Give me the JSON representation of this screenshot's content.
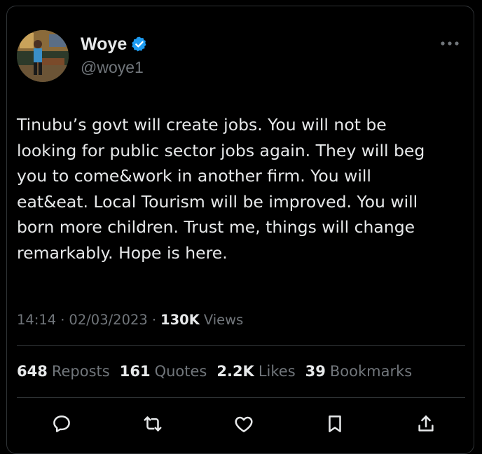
{
  "user": {
    "display_name": "Woye",
    "handle": "@woye1"
  },
  "tweet": {
    "text": "Tinubu’s govt will create jobs. You will not be\nlooking for public sector jobs again. They will beg\nyou to come&work in another firm. You will\neat&eat. Local Tourism will be improved. You will\nborn more children. Trust me, things will change\nremarkably. Hope is here.",
    "time": "14:14",
    "date": "02/03/2023",
    "separator": "·",
    "views_count": "130K",
    "views_label": "Views"
  },
  "stats": [
    {
      "count": "648",
      "label": "Reposts"
    },
    {
      "count": "161",
      "label": "Quotes"
    },
    {
      "count": "2.2K",
      "label": "Likes"
    },
    {
      "count": "39",
      "label": "Bookmarks"
    }
  ],
  "icons": {
    "verified": "verified-badge-icon",
    "more": "more-dots-icon",
    "reply": "reply-icon",
    "repost": "repost-icon",
    "like": "heart-icon",
    "bookmark": "bookmark-icon",
    "share": "share-icon"
  },
  "colors": {
    "background": "#000000",
    "text": "#e7e9ea",
    "secondary": "#71767b",
    "border": "#2f3336",
    "verified": "#1d9bf0"
  }
}
